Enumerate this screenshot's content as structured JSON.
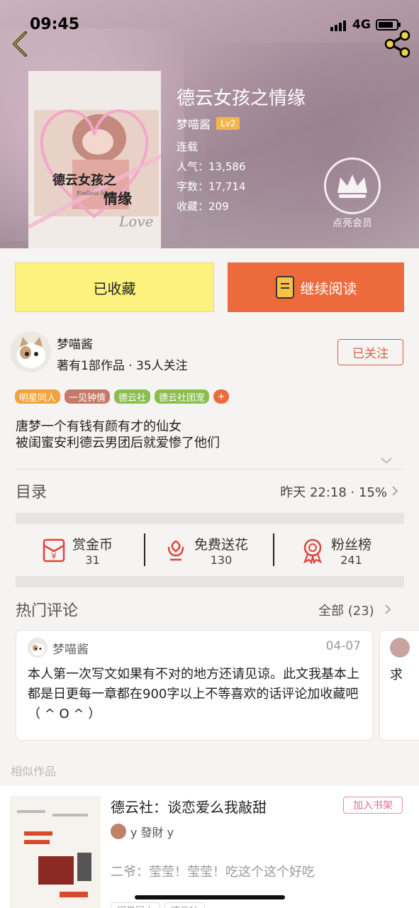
{
  "status_bar": {
    "time": "09:45",
    "network": "4G"
  },
  "book": {
    "title": "德云女孩之情缘",
    "author": "梦喵酱",
    "level": "Lv2",
    "status": "连载",
    "popularity_label": "人气：",
    "popularity": "13,586",
    "words_label": "字数：",
    "words": "17,714",
    "favorites_label": "收藏：",
    "favorites": "209",
    "vip_label": "点亮会员",
    "cover_text_cn": "德云女孩之",
    "cover_text_cn2": "情缘",
    "cover_text_en": "Endless love",
    "cover_text_love": "Love"
  },
  "buttons": {
    "collected": "已收藏",
    "continue_read": "继续阅读"
  },
  "author_block": {
    "name": "梦喵酱",
    "meta": "著有1部作品 · 35人关注",
    "follow_label": "已关注"
  },
  "tags": [
    {
      "label": "明星同人",
      "color": "#f2a43c"
    },
    {
      "label": "一见钟情",
      "color": "#c47a67"
    },
    {
      "label": "德云社",
      "color": "#8bbd4d"
    },
    {
      "label": "德云社团宠",
      "color": "#8bbd4d"
    }
  ],
  "tag_plus": "+",
  "description": {
    "line1": "唐梦一个有钱有颜有才的仙女",
    "line2": "被闺蜜安利德云男团后就爱惨了他们"
  },
  "catalog": {
    "title": "目录",
    "meta": "昨天 22:18 · 15%"
  },
  "actions": [
    {
      "label": "赏金币",
      "value": "31",
      "icon": "red-envelope-icon"
    },
    {
      "label": "免费送花",
      "value": "130",
      "icon": "flower-icon"
    },
    {
      "label": "粉丝榜",
      "value": "241",
      "icon": "medal-icon"
    }
  ],
  "hot_comments": {
    "title": "热门评论",
    "all_label": "全部 (23)",
    "items": [
      {
        "name": "梦喵酱",
        "date": "04-07",
        "text": "本人第一次写文如果有不对的地方还请见谅。此文我基本上都是日更每一章都在900字以上不等喜欢的话评论加收藏吧（ ^ O ^ ）"
      },
      {
        "text": "求"
      }
    ]
  },
  "similar": {
    "title": "相似作品",
    "item": {
      "title": "德云社：谈恋爱么我敲甜",
      "add_label": "加入书架",
      "author": "y 發財 y",
      "desc": "二爷：莹莹！莹莹！吃这个这个好吃",
      "tags": [
        "明星同人",
        "德云社"
      ]
    }
  },
  "colors": {
    "accent_orange": "#ec6a3c",
    "collect_yellow": "#fdf27e",
    "follow_red": "#e25a4a"
  }
}
